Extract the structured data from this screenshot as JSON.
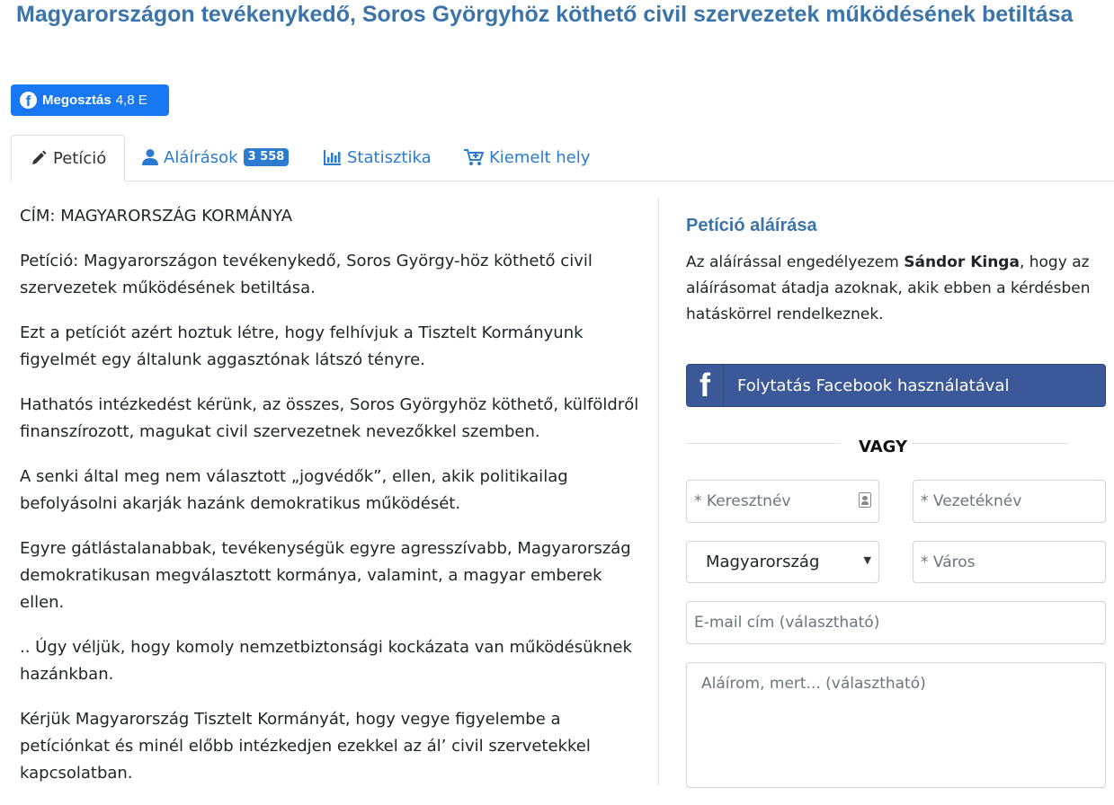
{
  "page": {
    "title": "Magyarországon tevékenykedő, Soros Györgyhöz köthető civil szervezetek működésének betiltása"
  },
  "share": {
    "label": "Megosztás",
    "count": "4,8 E",
    "icon": "facebook-icon"
  },
  "tabs": [
    {
      "label": "Petíció",
      "icon": "pencil-icon",
      "active": true
    },
    {
      "label": "Aláírások",
      "icon": "user-icon",
      "badge": "3 558"
    },
    {
      "label": "Statisztika",
      "icon": "bar-chart-icon"
    },
    {
      "label": "Kiemelt hely",
      "icon": "cart-plus-icon"
    }
  ],
  "petition": {
    "paragraphs": [
      "CÍM: MAGYARORSZÁG KORMÁNYA",
      "Petíció: Magyarországon tevékenykedő, Soros György-höz köthető civil szervezetek működésének betiltása.",
      "Ezt a petíciót azért hoztuk létre, hogy felhívjuk a Tisztelt Kormányunk figyelmét egy általunk aggasztónak látszó tényre.",
      "Hathatós intézkedést kérünk, az összes, Soros Györgyhöz köthető, külföldről finanszírozott, magukat civil szervezetnek nevezőkkel szemben.",
      "A senki által meg nem választott „jogvédők”, ellen, akik politikailag befolyásolni akarják hazánk demokratikus működését.",
      "Egyre gátlástalanabbak, tevékenységük egyre agresszívabb, Magyarország demokratikusan megválasztott kormánya, valamint, a magyar emberek ellen.",
      ".. Úgy véljük, hogy komoly nemzetbiztonsági kockázata van működésüknek hazánkban.",
      "Kérjük Magyarország Tisztelt Kormányát, hogy vegye figyelembe a petíciónkat és minél előbb intézkedjen ezekkel az ál’ civil szervetekkel kapcsolatban."
    ]
  },
  "sign": {
    "title": "Petíció aláírása",
    "text_before": "Az aláírással engedélyezem ",
    "author": "Sándor Kinga",
    "text_after": ", hogy az aláírásomat átadja azoknak, akik ebben a kérdésben hatáskörrel rendelkeznek.",
    "facebook_button": "Folytatás Facebook használatával",
    "or_label": "VAGY",
    "first_name_placeholder": "* Keresztnév",
    "last_name_placeholder": "* Vezetéknév",
    "country_value": "Magyarország",
    "city_placeholder": "* Város",
    "email_placeholder": "E-mail cím (választható)",
    "comment_placeholder": "Aláírom, mert... (választható)"
  },
  "colors": {
    "heading": "#3b74ab",
    "link": "#2b7bd0",
    "facebook_share": "#1877f2",
    "facebook_login": "#3b5998"
  }
}
